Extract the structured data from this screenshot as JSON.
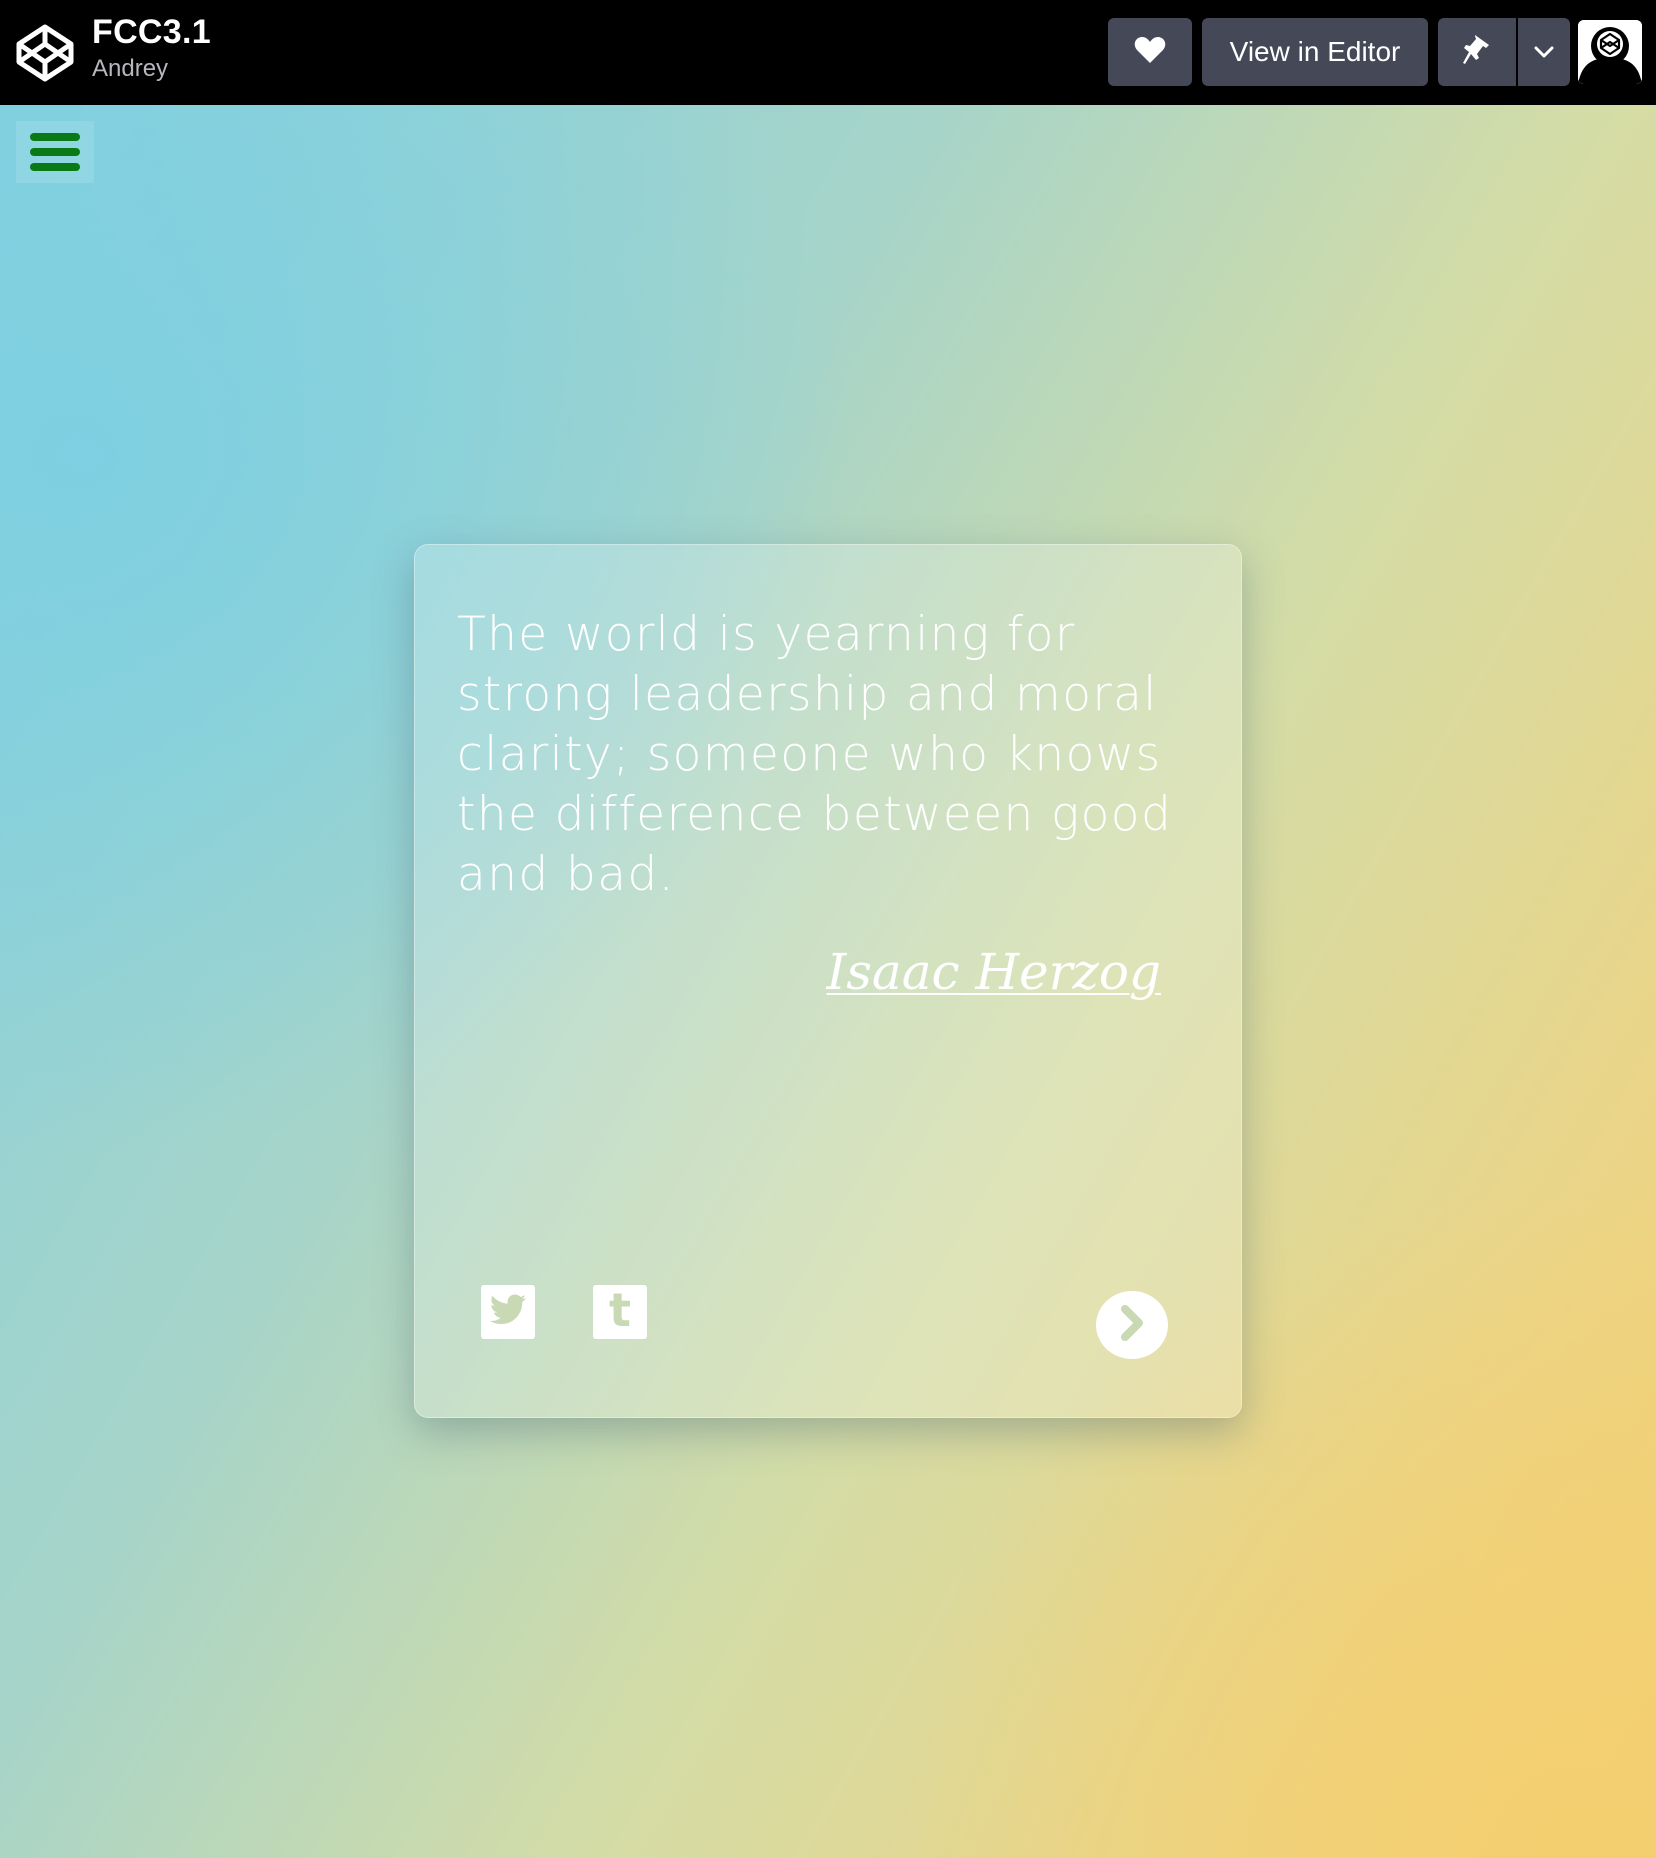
{
  "header": {
    "pen_title": "FCC3.1",
    "author_name": "Andrey",
    "editor_button_label": "View in Editor",
    "icons": {
      "logo": "codepen-logo-icon",
      "heart": "heart-icon",
      "pin": "pin-icon",
      "dropdown": "chevron-down-icon",
      "avatar": "user-avatar-icon"
    }
  },
  "menu": {
    "icon": "hamburger-menu-icon",
    "color": "#0a7a16"
  },
  "quote_card": {
    "text": "The world is yearning for strong leadership and moral clarity; someone who knows the difference between good and bad.",
    "author": "Isaac Herzog",
    "share": {
      "twitter_icon": "twitter-icon",
      "tumblr_icon": "tumblr-icon",
      "tumblr_glyph": "t"
    },
    "next_icon": "chevron-right-circle-icon"
  },
  "colors": {
    "topbar": "#000000",
    "button_bg": "#444857",
    "gradient_start": "#82d0e0",
    "gradient_end": "#f3cf74",
    "icon_tint": "#c8d9b4"
  }
}
